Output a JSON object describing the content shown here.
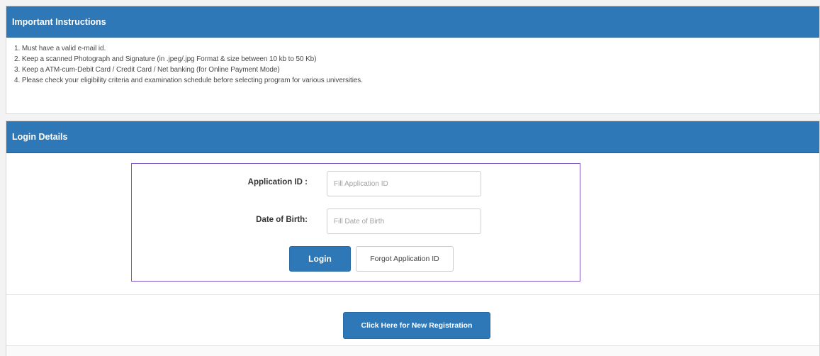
{
  "instructions": {
    "title": "Important Instructions",
    "items": [
      "1. Must have a valid e-mail id.",
      "2. Keep a scanned Photograph and Signature (in .jpeg/.jpg Format & size between 10 kb to 50 Kb)",
      "3. Keep a ATM-cum-Debit Card / Credit Card / Net banking (for Online Payment Mode)",
      "4. Please check your eligibility criteria and examination schedule before selecting program for various universities."
    ]
  },
  "login": {
    "title": "Login Details",
    "application_id": {
      "label": "Application ID :",
      "placeholder": "Fill Application ID",
      "value": ""
    },
    "dob": {
      "label": "Date of Birth:",
      "placeholder": "Fill Date of Birth",
      "value": ""
    },
    "login_button": "Login",
    "forgot_button": "Forgot Application ID"
  },
  "registration": {
    "button": "Click Here for New Registration"
  },
  "colors": {
    "header_blue": "#2e78b8",
    "login_box_border": "#7e57c2"
  }
}
